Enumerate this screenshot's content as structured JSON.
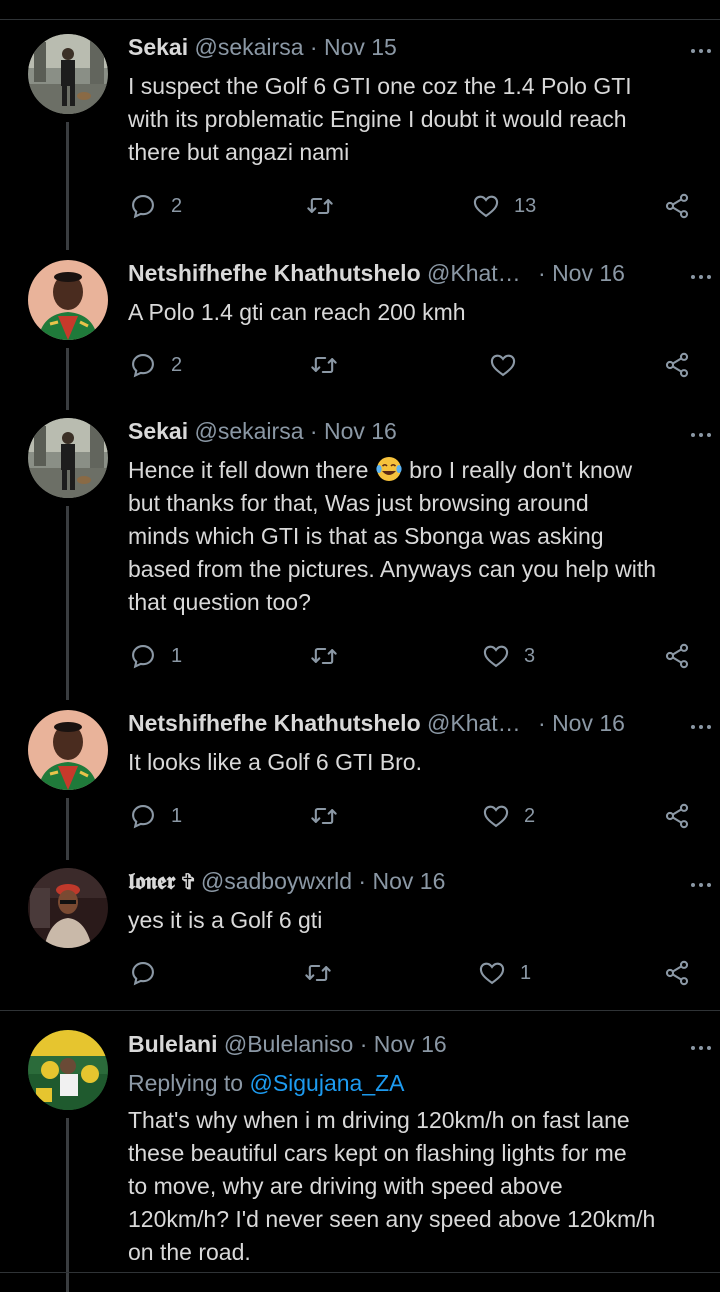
{
  "tweets": [
    {
      "name": "Sekai",
      "handle": "@sekairsa",
      "sep": "·",
      "time": "Nov 15",
      "lines": [
        "I suspect the Golf 6 GTI one coz the 1.4 Polo GTI",
        "with its problematic Engine I doubt it would reach",
        "there but angazi nami"
      ],
      "replies": "2",
      "retweets": "",
      "likes": "13"
    },
    {
      "name": "Netshifhefhe Khathutshelo",
      "handle": "@Khat…",
      "sep": "·",
      "time": "Nov 16",
      "lines": [
        "A Polo 1.4 gti can reach 200 kmh"
      ],
      "replies": "2",
      "retweets": "",
      "likes": ""
    },
    {
      "name": "Sekai",
      "handle": "@sekairsa",
      "sep": "·",
      "time": "Nov 16",
      "line1a": "Hence it fell down there",
      "line1b": "bro I really don't know",
      "lines": [
        "but thanks for that, Was just browsing around",
        "minds which GTI is that as Sbonga was asking",
        "based from the pictures. Anyways can you help with",
        "that question too?"
      ],
      "replies": "1",
      "retweets": "",
      "likes": "3"
    },
    {
      "name": "Netshifhefhe Khathutshelo",
      "handle": "@Khat…",
      "sep": "·",
      "time": "Nov 16",
      "lines": [
        "It looks like a Golf 6 GTI Bro."
      ],
      "replies": "1",
      "retweets": "",
      "likes": "2"
    },
    {
      "name": "𝖑𝖔𝖓𝖊𝖗 ✞",
      "handle": "@sadboywxrld",
      "sep": "·",
      "time": "Nov 16",
      "lines": [
        "yes it is a Golf 6 gti"
      ],
      "replies": "",
      "retweets": "",
      "likes": "1"
    },
    {
      "name": "Bulelani",
      "handle": "@Bulelaniso",
      "sep": "·",
      "time": "Nov 16",
      "replying_prefix": "Replying to",
      "replying_to": "@Sigujana_ZA",
      "lines": [
        "That's why when i m driving 120km/h on fast lane",
        "these beautiful cars kept on flashing lights for me",
        "to move, why are driving with speed above",
        "120km/h? I'd never seen any speed above 120km/h",
        "on the road."
      ]
    }
  ],
  "colors": {
    "background": "#000000",
    "text": "#d9d9d9",
    "secondary": "#8b98a5",
    "link": "#1d9bf0",
    "divider": "#2f3336"
  },
  "icons": [
    "reply-icon",
    "retweet-icon",
    "like-icon",
    "share-icon",
    "more-icon",
    "tears-of-joy-emoji"
  ]
}
